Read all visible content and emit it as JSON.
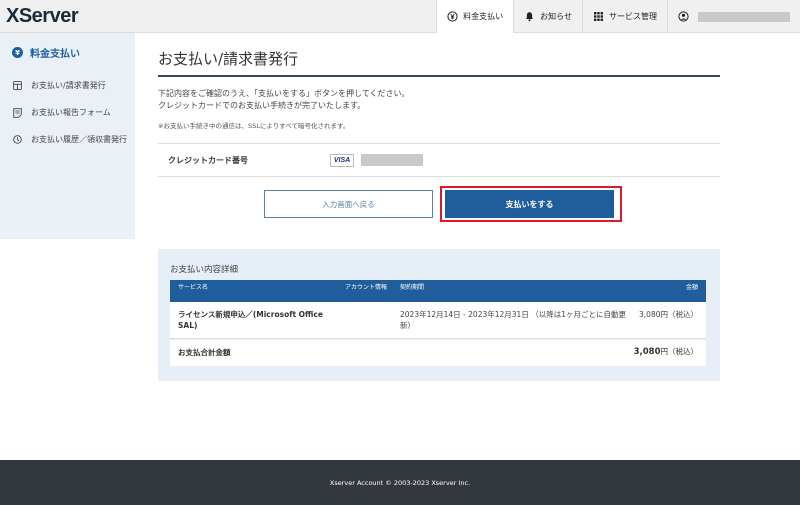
{
  "header": {
    "logo": "XServer",
    "nav": [
      {
        "label": "料金支払い",
        "icon": "yen-circle-icon",
        "active": true
      },
      {
        "label": "お知らせ",
        "icon": "bell-icon"
      },
      {
        "label": "サービス管理",
        "icon": "grid-icon"
      }
    ]
  },
  "sidebar": {
    "title": "料金支払い",
    "title_icon_glyph": "¥",
    "items": [
      {
        "label": "お支払い/請求書発行",
        "icon": "calculator-icon"
      },
      {
        "label": "お支払い報告フォーム",
        "icon": "form-icon"
      },
      {
        "label": "お支払い履歴／領収書発行",
        "icon": "history-icon"
      }
    ]
  },
  "main": {
    "title": "お支払い/請求書発行",
    "desc_line1": "下記内容をご確認のうえ、「支払いをする」ボタンを押してください。",
    "desc_line2": "クレジットカードでのお支払い手続きが完了いたします。",
    "note": "※お支払い手続き中の通信は、SSLによりすべて暗号化されます。",
    "card_label": "クレジットカード番号",
    "card_brand": "VISA",
    "back_button": "入力画面へ戻る",
    "pay_button": "支払いをする"
  },
  "details": {
    "title": "お支払い内容詳細",
    "columns": {
      "service": "サービス名",
      "account": "アカウント情報",
      "period": "契約期間",
      "amount": "金額"
    },
    "rows": [
      {
        "service": "ライセンス新規申込／(Microsoft Office SAL)",
        "period": "2023年12月14日 - 2023年12月31日 （以降は1ヶ月ごとに自動更新）",
        "amount": "3,080円（税込）"
      }
    ],
    "total_label": "お支払合計金額",
    "total_value": "3,080",
    "total_unit": "円（税込）"
  },
  "footer": {
    "copyright": "Xserver Account © 2003-2023 Xserver Inc."
  },
  "colors": {
    "primary": "#1f5d9c",
    "highlight_frame": "#e0182c",
    "sidebar_bg": "#eaf0f6",
    "footer_bg": "#33383e"
  }
}
